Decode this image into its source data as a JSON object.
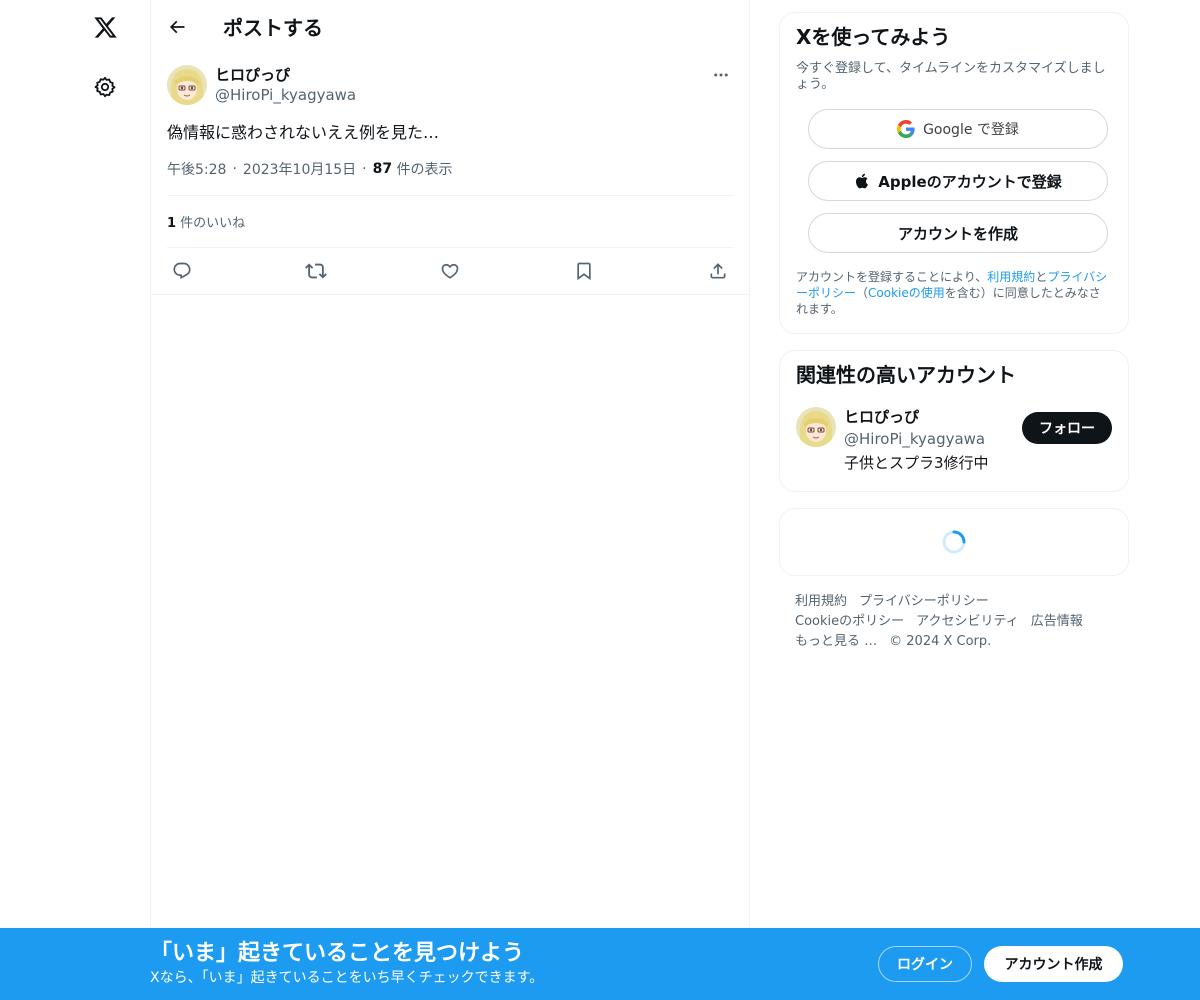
{
  "nav": {
    "logo_icon": "x-logo-icon",
    "settings_icon": "gear-icon"
  },
  "header": {
    "back_icon": "arrow-left-icon",
    "title": "ポストする"
  },
  "post": {
    "author_name": "ヒロぴっぴ",
    "author_handle": "@HiroPi_kyagyawa",
    "text": "偽情報に惑わされないええ例を見た…",
    "time": "午後5:28",
    "date": "2023年10月15日",
    "views_count": "87",
    "views_label": " 件の表示",
    "likes_count": "1",
    "likes_label": " 件のいいね",
    "actions": [
      "reply-icon",
      "repost-icon",
      "like-icon",
      "bookmark-icon",
      "share-icon"
    ]
  },
  "signup_card": {
    "title": "Xを使ってみよう",
    "subtitle": "今すぐ登録して、タイムラインをカスタマイズしましょう。",
    "google_label": "Google で登録",
    "apple_label": "Appleのアカウントで登録",
    "create_label": "アカウントを作成",
    "terms_prefix": "アカウントを登録することにより、",
    "terms_link": "利用規約",
    "terms_and": "と",
    "privacy_link": "プライバシーポリシー",
    "terms_paren_open": "（",
    "cookie_link": "Cookieの使用",
    "terms_suffix": "を含む）に同意したとみなされます。"
  },
  "related_card": {
    "title": "関連性の高いアカウント",
    "name": "ヒロぴっぴ",
    "handle": "@HiroPi_kyagyawa",
    "bio": "子供とスプラ3修行中",
    "follow_label": "フォロー"
  },
  "footer": {
    "terms": "利用規約",
    "privacy": "プライバシーポリシー",
    "cookie": "Cookieのポリシー",
    "accessibility": "アクセシビリティ",
    "ads": "広告情報",
    "more": "もっと見る …",
    "copyright": "© 2024 X Corp."
  },
  "bottom_bar": {
    "title": "「いま」起きていることを見つけよう",
    "subtitle": "Xなら、「いま」起きていることをいち早くチェックできます。",
    "login_label": "ログイン",
    "signup_label": "アカウント作成"
  },
  "colors": {
    "accent": "#1d9bf0",
    "text": "#0f1419",
    "muted": "#536471",
    "border": "#eff3f4"
  }
}
